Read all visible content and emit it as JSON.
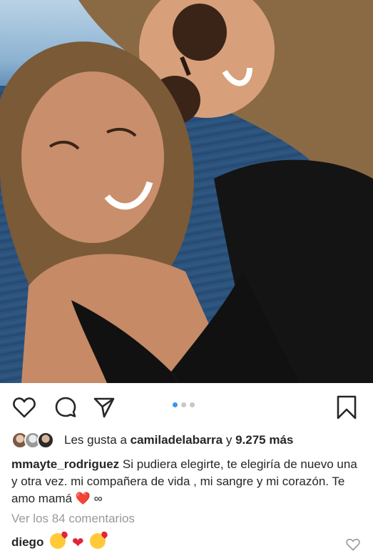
{
  "post": {
    "likes": {
      "prefix": "Les gusta a",
      "user": "camiladelabarra",
      "joiner": "y",
      "count": "9.275 más"
    },
    "caption": {
      "username": "mmayte_rodriguez",
      "text": "Si pudiera elegirte, te elegiría de nuevo una y otra vez. mi compañera de vida , mi sangre y mi corazón. Te amo mamá",
      "emoji_heart": "❤️",
      "infinity": "∞"
    },
    "view_comments": "Ver los 84 comentarios",
    "comment": {
      "username": "diego",
      "emojis": [
        "kissing-face",
        "red-heart",
        "kissing-face"
      ]
    },
    "carousel": {
      "index": 1,
      "count": 3
    },
    "actions": {
      "like_icon": "heart-icon",
      "comment_icon": "comment-icon",
      "share_icon": "send-icon",
      "save_icon": "bookmark-icon"
    },
    "colors": {
      "accent": "#3897f0",
      "text": "#262626",
      "muted": "#999999",
      "heart": "#e0243a"
    }
  }
}
